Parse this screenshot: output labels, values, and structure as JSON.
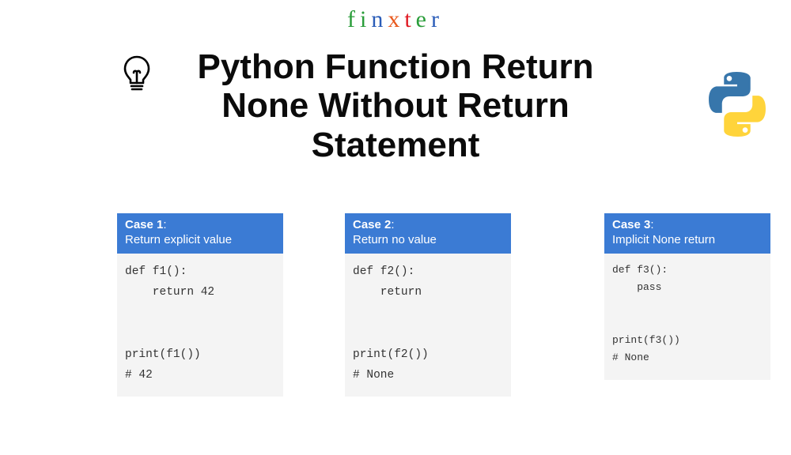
{
  "brand": {
    "letters": [
      "f",
      "i",
      "n",
      "x",
      "t",
      "e",
      "r"
    ],
    "colors": [
      "#2a9d3a",
      "#2a9d3a",
      "#2b5db8",
      "#e9591d",
      "#e01b24",
      "#2a9d3a",
      "#2b5db8"
    ]
  },
  "title": "Python Function Return None Without Return Statement",
  "cases": [
    {
      "num": "Case 1",
      "desc": "Return explicit value",
      "code": "def f1():\n    return 42\n\n\nprint(f1())\n# 42"
    },
    {
      "num": "Case 2",
      "desc": "Return no value",
      "code": "def f2():\n    return\n\n\nprint(f2())\n# None"
    },
    {
      "num": "Case 3",
      "desc": "Implicit None return",
      "code": "def f3():\n    pass\n\n\nprint(f3())\n# None"
    }
  ]
}
